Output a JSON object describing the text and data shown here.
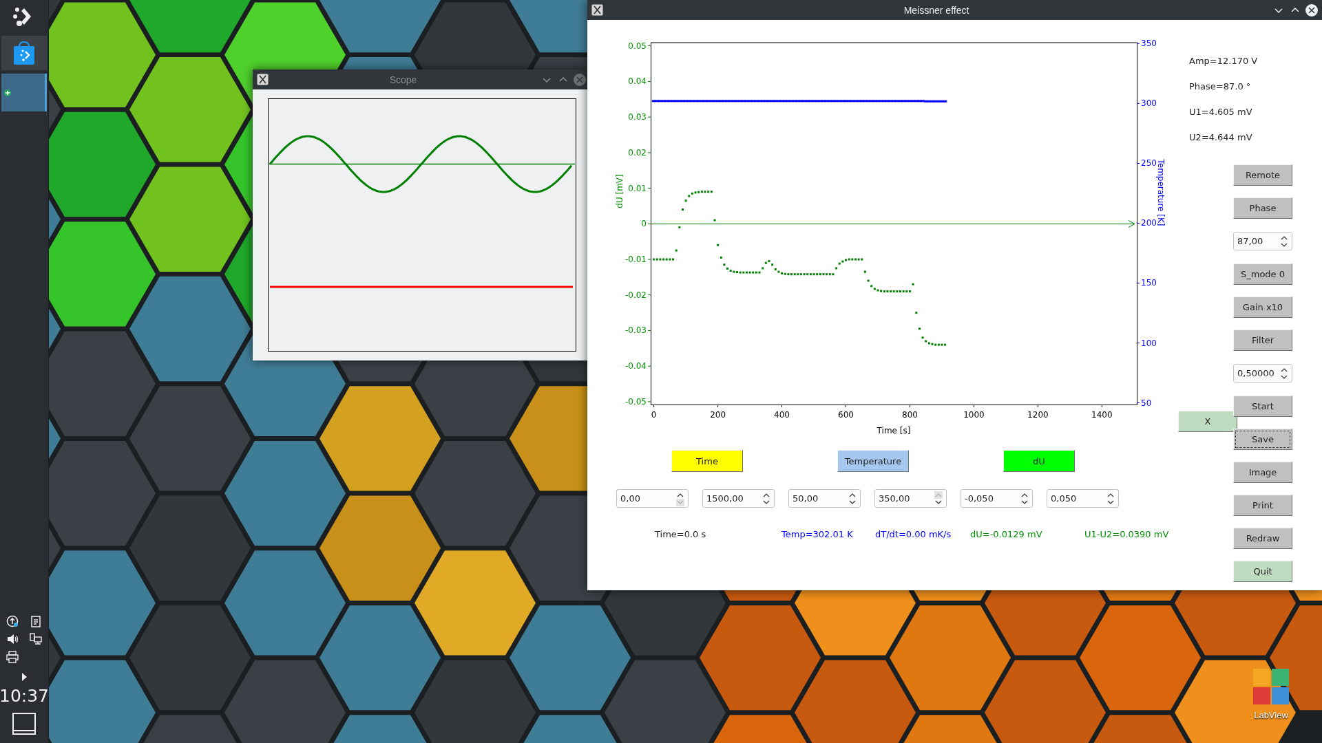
{
  "taskbar": {
    "clock": "10:37"
  },
  "desktop_icons": [
    {
      "label": "LabView"
    }
  ],
  "scope_window": {
    "title": "Scope",
    "active": false
  },
  "main_window": {
    "title": "Meissner effect",
    "active": true,
    "chart_data": {
      "type": "scatter",
      "xlabel": "Time [s]",
      "ylabel": "dU [mV]",
      "y2label": "Temperature [K]",
      "ref_lines": [
        {
          "axis": "y",
          "value": 0,
          "color": "#008000"
        }
      ],
      "xlim": [
        -10,
        1509
      ],
      "ylim": [
        -0.0508,
        0.051
      ],
      "y2lim": [
        48.6,
        351
      ],
      "xticks": [
        0,
        200,
        400,
        600,
        800,
        1000,
        1200,
        1400
      ],
      "yticks": [
        0.05,
        0.04,
        0.03,
        0.02,
        0.01,
        0,
        -0.01,
        -0.02,
        -0.03,
        -0.04,
        -0.05
      ],
      "y2ticks": [
        350,
        300,
        250,
        200,
        150,
        100,
        50
      ],
      "x": [
        0,
        10,
        20,
        30,
        40,
        50,
        60,
        70,
        80,
        90,
        100,
        110,
        120,
        130,
        140,
        150,
        160,
        170,
        180,
        190,
        200,
        210,
        220,
        230,
        240,
        250,
        260,
        270,
        280,
        290,
        300,
        310,
        320,
        330,
        340,
        350,
        360,
        370,
        380,
        390,
        400,
        410,
        420,
        430,
        440,
        450,
        460,
        470,
        480,
        490,
        500,
        510,
        520,
        530,
        540,
        550,
        560,
        570,
        580,
        590,
        600,
        610,
        620,
        630,
        640,
        650,
        660,
        670,
        680,
        690,
        700,
        710,
        720,
        730,
        740,
        750,
        760,
        770,
        780,
        790,
        800,
        810,
        820,
        830,
        840,
        850,
        860,
        870,
        880,
        890,
        900,
        910
      ],
      "series": [
        {
          "color": "#008000",
          "values": [
            -0.01,
            -0.01,
            -0.01,
            -0.01,
            -0.01,
            -0.01,
            -0.01,
            -0.0075,
            -0.001,
            0.004,
            0.0065,
            0.0078,
            0.0085,
            0.0088,
            0.0089,
            0.009,
            0.009,
            0.009,
            0.009,
            0.001,
            -0.006,
            -0.0095,
            -0.0115,
            -0.0126,
            -0.0132,
            -0.0135,
            -0.0136,
            -0.0137,
            -0.0137,
            -0.0137,
            -0.0137,
            -0.0137,
            -0.0137,
            -0.0137,
            -0.0125,
            -0.011,
            -0.0105,
            -0.0115,
            -0.0128,
            -0.0135,
            -0.0139,
            -0.0141,
            -0.0142,
            -0.0142,
            -0.0142,
            -0.0142,
            -0.0142,
            -0.0142,
            -0.0142,
            -0.0142,
            -0.0142,
            -0.0142,
            -0.0142,
            -0.0142,
            -0.0142,
            -0.0142,
            -0.0142,
            -0.0125,
            -0.0112,
            -0.0106,
            -0.0102,
            -0.01,
            -0.01,
            -0.01,
            -0.01,
            -0.01,
            -0.0135,
            -0.016,
            -0.0175,
            -0.0183,
            -0.0187,
            -0.0189,
            -0.019,
            -0.019,
            -0.019,
            -0.019,
            -0.019,
            -0.019,
            -0.019,
            -0.019,
            -0.019,
            -0.017,
            -0.025,
            -0.0295,
            -0.032,
            -0.033,
            -0.0336,
            -0.0338,
            -0.034,
            -0.034,
            -0.034,
            -0.034
          ]
        },
        {
          "color": "#0000ff",
          "axis": "y2",
          "values": [
            302,
            302,
            302,
            302,
            302,
            302,
            302,
            302,
            302,
            302,
            302,
            302,
            302,
            302,
            302,
            302,
            302,
            302,
            302,
            302,
            302,
            302,
            302,
            302,
            302,
            302,
            302,
            302,
            302,
            302,
            302,
            302,
            302,
            302,
            302,
            302,
            302,
            302,
            302,
            302,
            302,
            302,
            302,
            302,
            302,
            302,
            302,
            302,
            302,
            302,
            302,
            302,
            302,
            302,
            302,
            302,
            302,
            302,
            302,
            302,
            302,
            302,
            302,
            302,
            302,
            302,
            302,
            302,
            302,
            302,
            302,
            302,
            302,
            302,
            302,
            302,
            302,
            302,
            302,
            302,
            302,
            302,
            302,
            302,
            302,
            301.7,
            301.7,
            301.7,
            301.7,
            301.7,
            301.7,
            301.7
          ]
        }
      ]
    },
    "axis_buttons": [
      {
        "label": "Time",
        "color": "#ffff00"
      },
      {
        "label": "Temperature",
        "color": "#a6c8f0"
      },
      {
        "label": "dU",
        "color": "#00ff00"
      }
    ],
    "range_fields": [
      {
        "value": "0,00",
        "up_disabled": false,
        "down_disabled": true
      },
      {
        "value": "1500,00",
        "up_disabled": false,
        "down_disabled": false
      },
      {
        "value": "50,00",
        "up_disabled": false,
        "down_disabled": false
      },
      {
        "value": "350,00",
        "up_disabled": true,
        "down_disabled": false
      },
      {
        "value": "-0,050",
        "up_disabled": false,
        "down_disabled": false
      },
      {
        "value": "0,050",
        "up_disabled": false,
        "down_disabled": false
      }
    ],
    "status": [
      {
        "text": "Time=0.0 s",
        "color": "#222222"
      },
      {
        "text": "Temp=302.01 K",
        "color": "#0000ff"
      },
      {
        "text": "dT/dt=0.00 mK/s",
        "color": "#0000ff"
      },
      {
        "text": "dU=-0.0129 mV",
        "color": "#008f00"
      },
      {
        "text": "U1-U2=0.0390 mV",
        "color": "#008f00"
      }
    ],
    "readouts": [
      "Amp=12.170 V",
      "Phase=87.0 °",
      "U1=4.605 mV",
      "U2=4.644 mV"
    ],
    "x_button": {
      "label": "X",
      "color": "#c0dcc0"
    },
    "controls": [
      {
        "kind": "button",
        "label": "Remote",
        "color": "#c0c0c0",
        "focused": false
      },
      {
        "kind": "button",
        "label": "Phase",
        "color": "#c0c0c0",
        "focused": false
      },
      {
        "kind": "spinbox",
        "value": "87,00",
        "up_disabled": false,
        "down_disabled": false
      },
      {
        "kind": "button",
        "label": "S_mode 0",
        "color": "#c0c0c0",
        "focused": false
      },
      {
        "kind": "button",
        "label": "Gain x10",
        "color": "#c0c0c0",
        "focused": false
      },
      {
        "kind": "button",
        "label": "Filter",
        "color": "#c0c0c0",
        "focused": false
      },
      {
        "kind": "spinbox",
        "value": "0,50000",
        "up_disabled": false,
        "down_disabled": false
      },
      {
        "kind": "button",
        "label": "Start",
        "color": "#c0c0c0",
        "focused": false
      },
      {
        "kind": "button",
        "label": "Save",
        "color": "#c0c0c0",
        "focused": true
      },
      {
        "kind": "button",
        "label": "Image",
        "color": "#c0c0c0",
        "focused": false
      },
      {
        "kind": "button",
        "label": "Print",
        "color": "#c0c0c0",
        "focused": false
      },
      {
        "kind": "button",
        "label": "Redraw",
        "color": "#c0c0c0",
        "focused": false
      },
      {
        "kind": "button",
        "label": "Quit",
        "color": "#c0dcc0",
        "focused": false
      }
    ]
  }
}
